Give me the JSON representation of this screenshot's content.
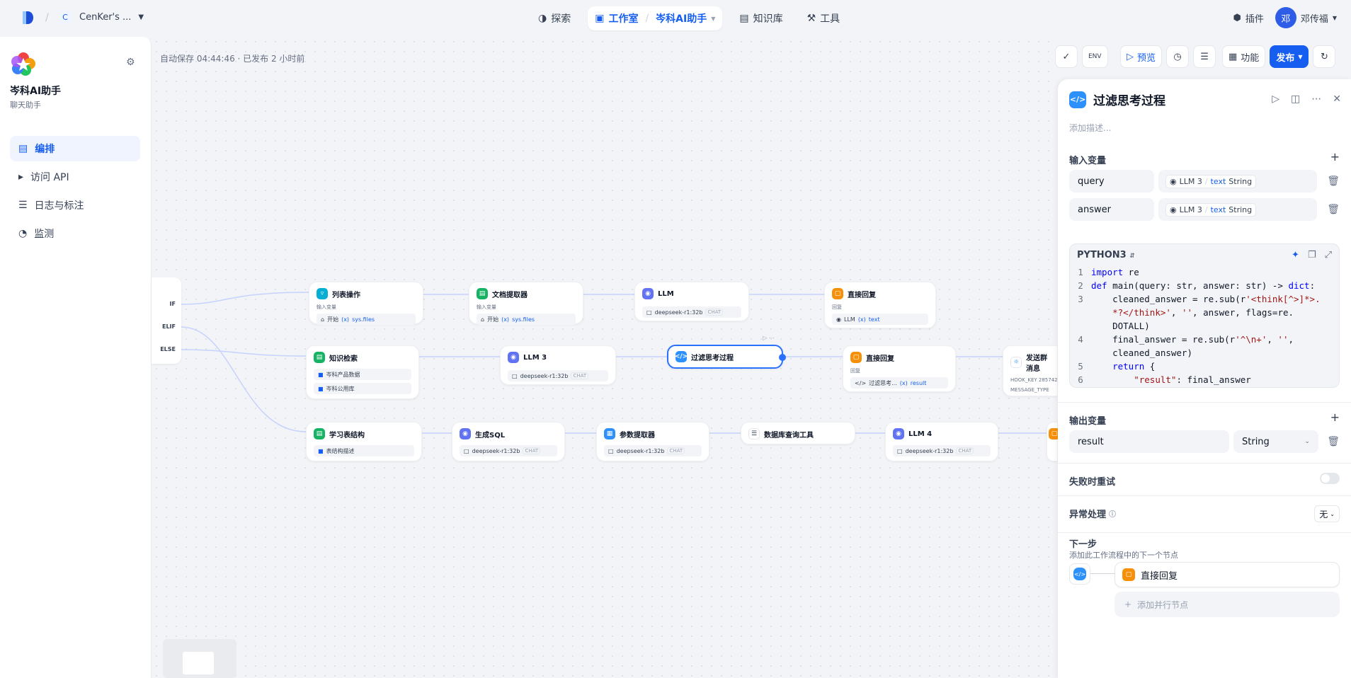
{
  "topbar": {
    "workspace_initial": "C",
    "workspace_name": "CenKer's ...",
    "nav": [
      {
        "label": "探索"
      },
      {
        "label": "工作室"
      },
      {
        "label": "岑科AI助手"
      },
      {
        "label": "知识库"
      },
      {
        "label": "工具"
      }
    ],
    "plugins": "插件",
    "avatar_initial": "邓",
    "user_name": "邓传福"
  },
  "sidebar": {
    "app_name": "岑科AI助手",
    "app_type": "聊天助手",
    "items": [
      {
        "label": "编排",
        "selected": true
      },
      {
        "label": "访问 API"
      },
      {
        "label": "日志与标注"
      },
      {
        "label": "监测"
      }
    ]
  },
  "canvas": {
    "autosave": "自动保存 04:44:46 · 已发布 2 小时前",
    "branches": [
      "IF",
      "ELIF",
      "ELSE"
    ],
    "nodes": [
      {
        "title": "列表操作",
        "sub": "输入变量",
        "src": "开始",
        "var": "sys.files"
      },
      {
        "title": "文档提取器",
        "sub": "输入变量",
        "src": "开始",
        "var": "sys.files"
      },
      {
        "title": "LLM",
        "model": "deepseek-r1:32b",
        "tag": "CHAT"
      },
      {
        "title": "直接回复",
        "sub": "回复",
        "src": "LLM",
        "var": "text"
      },
      {
        "title": "知识检索",
        "kb1": "岑科产品数据",
        "kb2": "岑科公用库"
      },
      {
        "title": "LLM 3",
        "model": "deepseek-r1:32b",
        "tag": "CHAT"
      },
      {
        "title": "过滤思考过程"
      },
      {
        "title": "直接回复",
        "sub": "回复",
        "src": "过滤思考...",
        "var": "result"
      },
      {
        "title": "发送群消息",
        "l1": "HOOK_KEY 285742...",
        "l2": "MESSAGE_TYPE"
      },
      {
        "title": "学习表结构",
        "row": "表结构描述"
      },
      {
        "title": "生成SQL",
        "model": "deepseek-r1:32b",
        "tag": "CHAT"
      },
      {
        "title": "参数提取器",
        "model": "deepseek-r1:32b",
        "tag": "CHAT"
      },
      {
        "title": "数据库查询工具"
      },
      {
        "title": "LLM 4",
        "model": "deepseek-r1:32b",
        "tag": "CHAT"
      }
    ],
    "x_prefix": "(x)"
  },
  "toolbar": {
    "preview": "预览",
    "features": "功能",
    "publish": "发布"
  },
  "panel": {
    "title": "过滤思考过程",
    "description_placeholder": "添加描述...",
    "input_section": "输入变量",
    "inputs": [
      {
        "name": "query",
        "node": "LLM 3",
        "var": "text",
        "type": "String"
      },
      {
        "name": "answer",
        "node": "LLM 3",
        "var": "text",
        "type": "String"
      }
    ],
    "language": "PYTHON3",
    "code_lines": [
      {
        "n": "1",
        "html": "<span class='kw'>import</span> re"
      },
      {
        "n": "2",
        "html": "<span class='kw'>def</span> main(query: str, answer: str) -> <span class='kw'>dict</span>:"
      },
      {
        "n": "3",
        "html": "    cleaned_answer = re.sub(r<span class='st'>'&lt;think[^&gt;]*&gt;.</span>"
      },
      {
        "n": "",
        "html": "    <span class='st'>*?&lt;/think&gt;'</span>, <span class='st'>''</span>, answer, flags=re."
      },
      {
        "n": "",
        "html": "    DOTALL)"
      },
      {
        "n": "4",
        "html": "    final_answer = re.sub(r<span class='st'>'^\\n+'</span>, <span class='st'>''</span>,"
      },
      {
        "n": "",
        "html": "    cleaned_answer)"
      },
      {
        "n": "5",
        "html": "    <span class='kw'>return</span> {"
      },
      {
        "n": "6",
        "html": "        <span class='st'>\"result\"</span>: final_answer"
      }
    ],
    "output_section": "输出变量",
    "output": {
      "name": "result",
      "type": "String"
    },
    "retry": "失败时重试",
    "error_handling": "异常处理",
    "error_value": "无",
    "next_step": "下一步",
    "next_step_desc": "添加此工作流程中的下一个节点",
    "next_node": "直接回复",
    "add_parallel": "添加并行节点"
  },
  "colors": {
    "accent": "#155eef",
    "code_node": "#2e90fa",
    "answer_node": "#f79009",
    "llm_node": "#6172f3",
    "kb_node": "#16b364",
    "list_node": "#06aed4"
  }
}
